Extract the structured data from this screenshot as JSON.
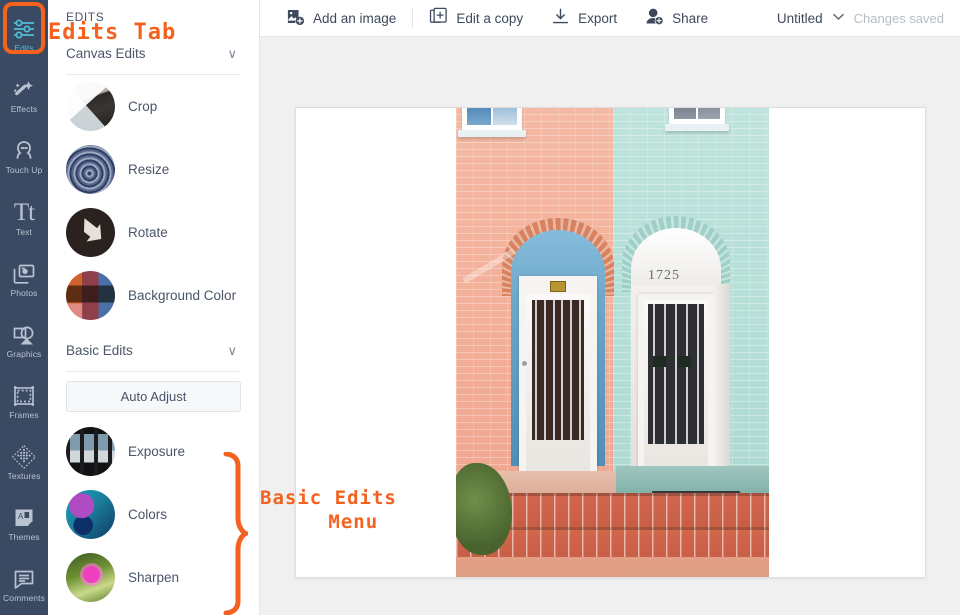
{
  "rail": {
    "items": [
      {
        "label": "Edits",
        "icon": "sliders-icon",
        "active": true
      },
      {
        "label": "Effects",
        "icon": "magic-wand-icon",
        "active": false
      },
      {
        "label": "Touch Up",
        "icon": "face-icon",
        "active": false
      },
      {
        "label": "Text",
        "icon": "text-tt-icon",
        "active": false
      },
      {
        "label": "Photos",
        "icon": "photos-icon",
        "active": false
      },
      {
        "label": "Graphics",
        "icon": "graphics-icon",
        "active": false
      },
      {
        "label": "Frames",
        "icon": "frames-icon",
        "active": false
      },
      {
        "label": "Textures",
        "icon": "textures-icon",
        "active": false
      },
      {
        "label": "Themes",
        "icon": "themes-icon",
        "active": false
      },
      {
        "label": "Comments",
        "icon": "comment-icon",
        "active": false
      }
    ]
  },
  "panel": {
    "title": "EDITS",
    "sections": [
      {
        "label": "Canvas Edits",
        "chevron": "∨",
        "items": [
          {
            "label": "Crop",
            "thumb": "crop-thumb"
          },
          {
            "label": "Resize",
            "thumb": "resize-thumb"
          },
          {
            "label": "Rotate",
            "thumb": "rotate-thumb"
          },
          {
            "label": "Background Color",
            "thumb": "background-color-thumb"
          }
        ]
      },
      {
        "label": "Basic Edits",
        "chevron": "∨",
        "auto_adjust_label": "Auto Adjust",
        "items": [
          {
            "label": "Exposure",
            "thumb": "exposure-thumb"
          },
          {
            "label": "Colors",
            "thumb": "colors-thumb"
          },
          {
            "label": "Sharpen",
            "thumb": "sharpen-thumb"
          }
        ]
      }
    ]
  },
  "toolbar": {
    "add_image_label": "Add an image",
    "edit_copy_label": "Edit a copy",
    "export_label": "Export",
    "share_label": "Share",
    "document_title": "Untitled",
    "document_chevron": "⌄",
    "status_text": "Changes saved"
  },
  "annotations": {
    "edits_tab": "Edits Tab",
    "basic_edits_menu": "Basic Edits\n    Menu",
    "color": "#f4621f"
  },
  "canvas": {
    "photo": {
      "door_number": "1725",
      "left_wall_color": "#f3ad96",
      "right_wall_color": "#b3ded7",
      "steps_color": "#c75f46"
    }
  },
  "colors": {
    "rail_bg": "#3b4a63",
    "rail_active": "#4fc0d8",
    "panel_text": "#4a5568",
    "workspace_bg": "#f0f0f0",
    "accent_orange": "#f4621f"
  }
}
